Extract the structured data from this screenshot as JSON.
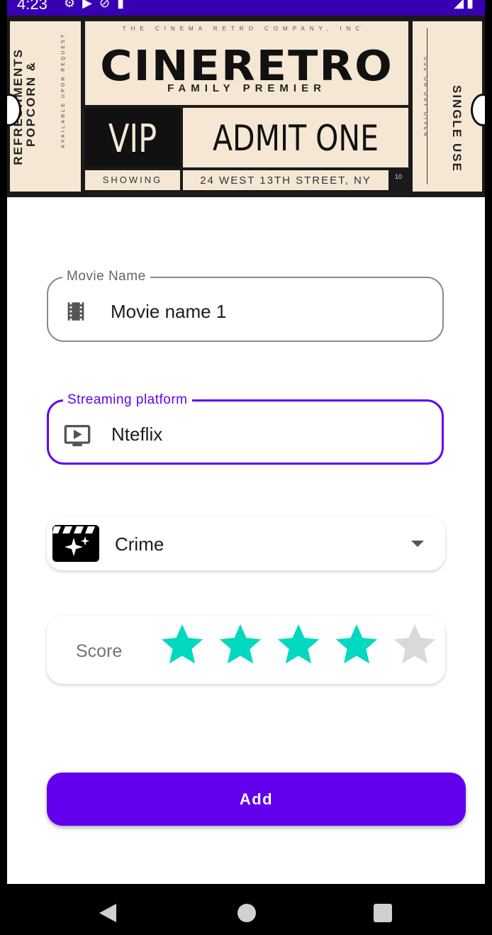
{
  "status_bar": {
    "time": "4:23",
    "icons_left": [
      "gear-icon",
      "play-protect-icon",
      "no-data-icon",
      "sd-card-icon"
    ],
    "icons_right": [
      "wifi-icon",
      "signal-icon",
      "battery-icon"
    ]
  },
  "banner": {
    "company": "THE CINEMA RETRO COMPANY, INC.",
    "brand": "CINERETRO",
    "subtitle": "FAMILY PREMIER",
    "vip": "VIP",
    "admit": "ADMIT ONE",
    "showing": "SHOWING",
    "address": "24 WEST 13TH STREET, NY",
    "number": "10",
    "left_line1": "POPCORN &",
    "left_line2": "REFRESHMENTS",
    "left_small": "AVAILABLE UPON REQUEST",
    "right_big": "SINGLE USE",
    "right_small": "USE ON DAY GIVEN"
  },
  "form": {
    "movie_name": {
      "label": "Movie Name",
      "value": "Movie name 1",
      "icon": "film-strip-icon"
    },
    "platform": {
      "label": "Streaming platform",
      "value": "Nteflix",
      "icon": "tv-play-icon"
    },
    "genre": {
      "value": "Crime",
      "icon": "clapperboard-sparkle-icon"
    },
    "score": {
      "label": "Score",
      "rating": 4,
      "max": 5,
      "filled_color": "#00d9c0",
      "empty_color": "#d9d9d9"
    },
    "add_label": "Add"
  },
  "colors": {
    "primary": "#6200ee",
    "status_bar": "#3700b3"
  },
  "nav": {
    "icons": [
      "back-icon",
      "home-icon",
      "recents-icon"
    ]
  }
}
